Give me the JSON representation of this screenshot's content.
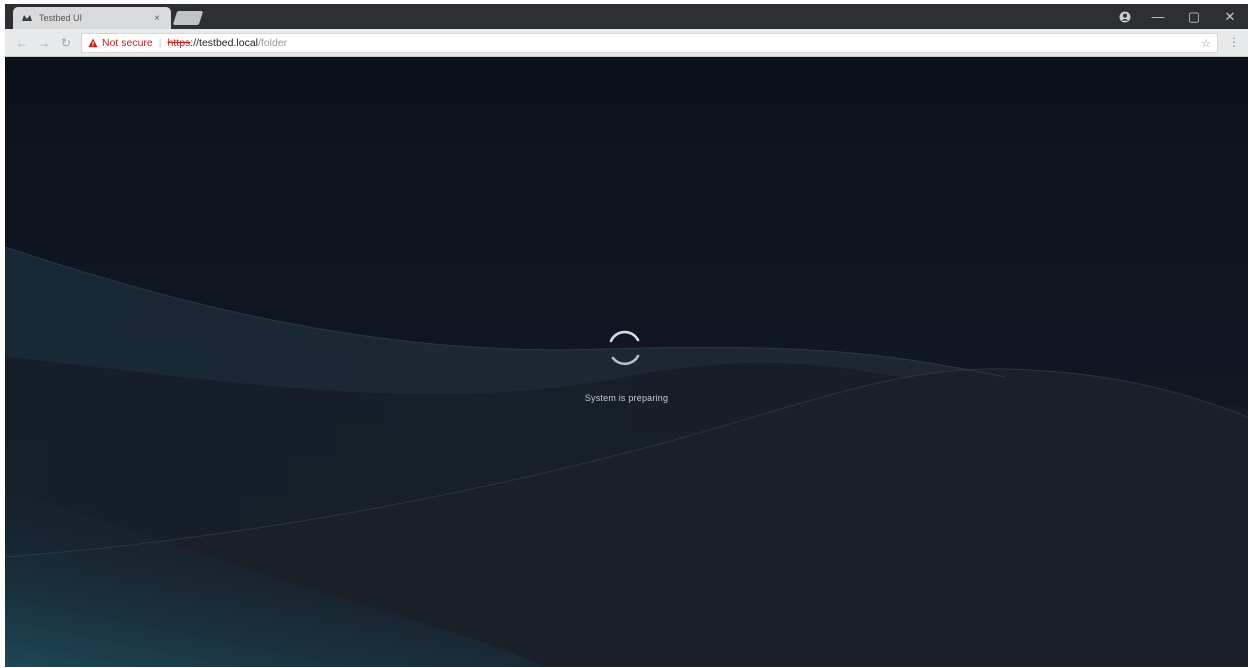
{
  "browser": {
    "tab_title": "Testbed UI",
    "tab_close": "×",
    "controls": {
      "profile_icon": "profile-icon",
      "minimize": "—",
      "maximize": "▢",
      "close": "✕"
    },
    "toolbar": {
      "back": "←",
      "forward": "→",
      "reload": "↻",
      "security_label": "Not secure",
      "separator": "|",
      "url_scheme": "https",
      "url_host": "://testbed.local",
      "url_path": "/folder",
      "star": "☆",
      "menu": "⋮"
    }
  },
  "page": {
    "status": "System is preparing",
    "colors": {
      "background": "#0f141c",
      "accent_teal": "#1f4f5f",
      "spinner": "#d7dadf"
    }
  }
}
